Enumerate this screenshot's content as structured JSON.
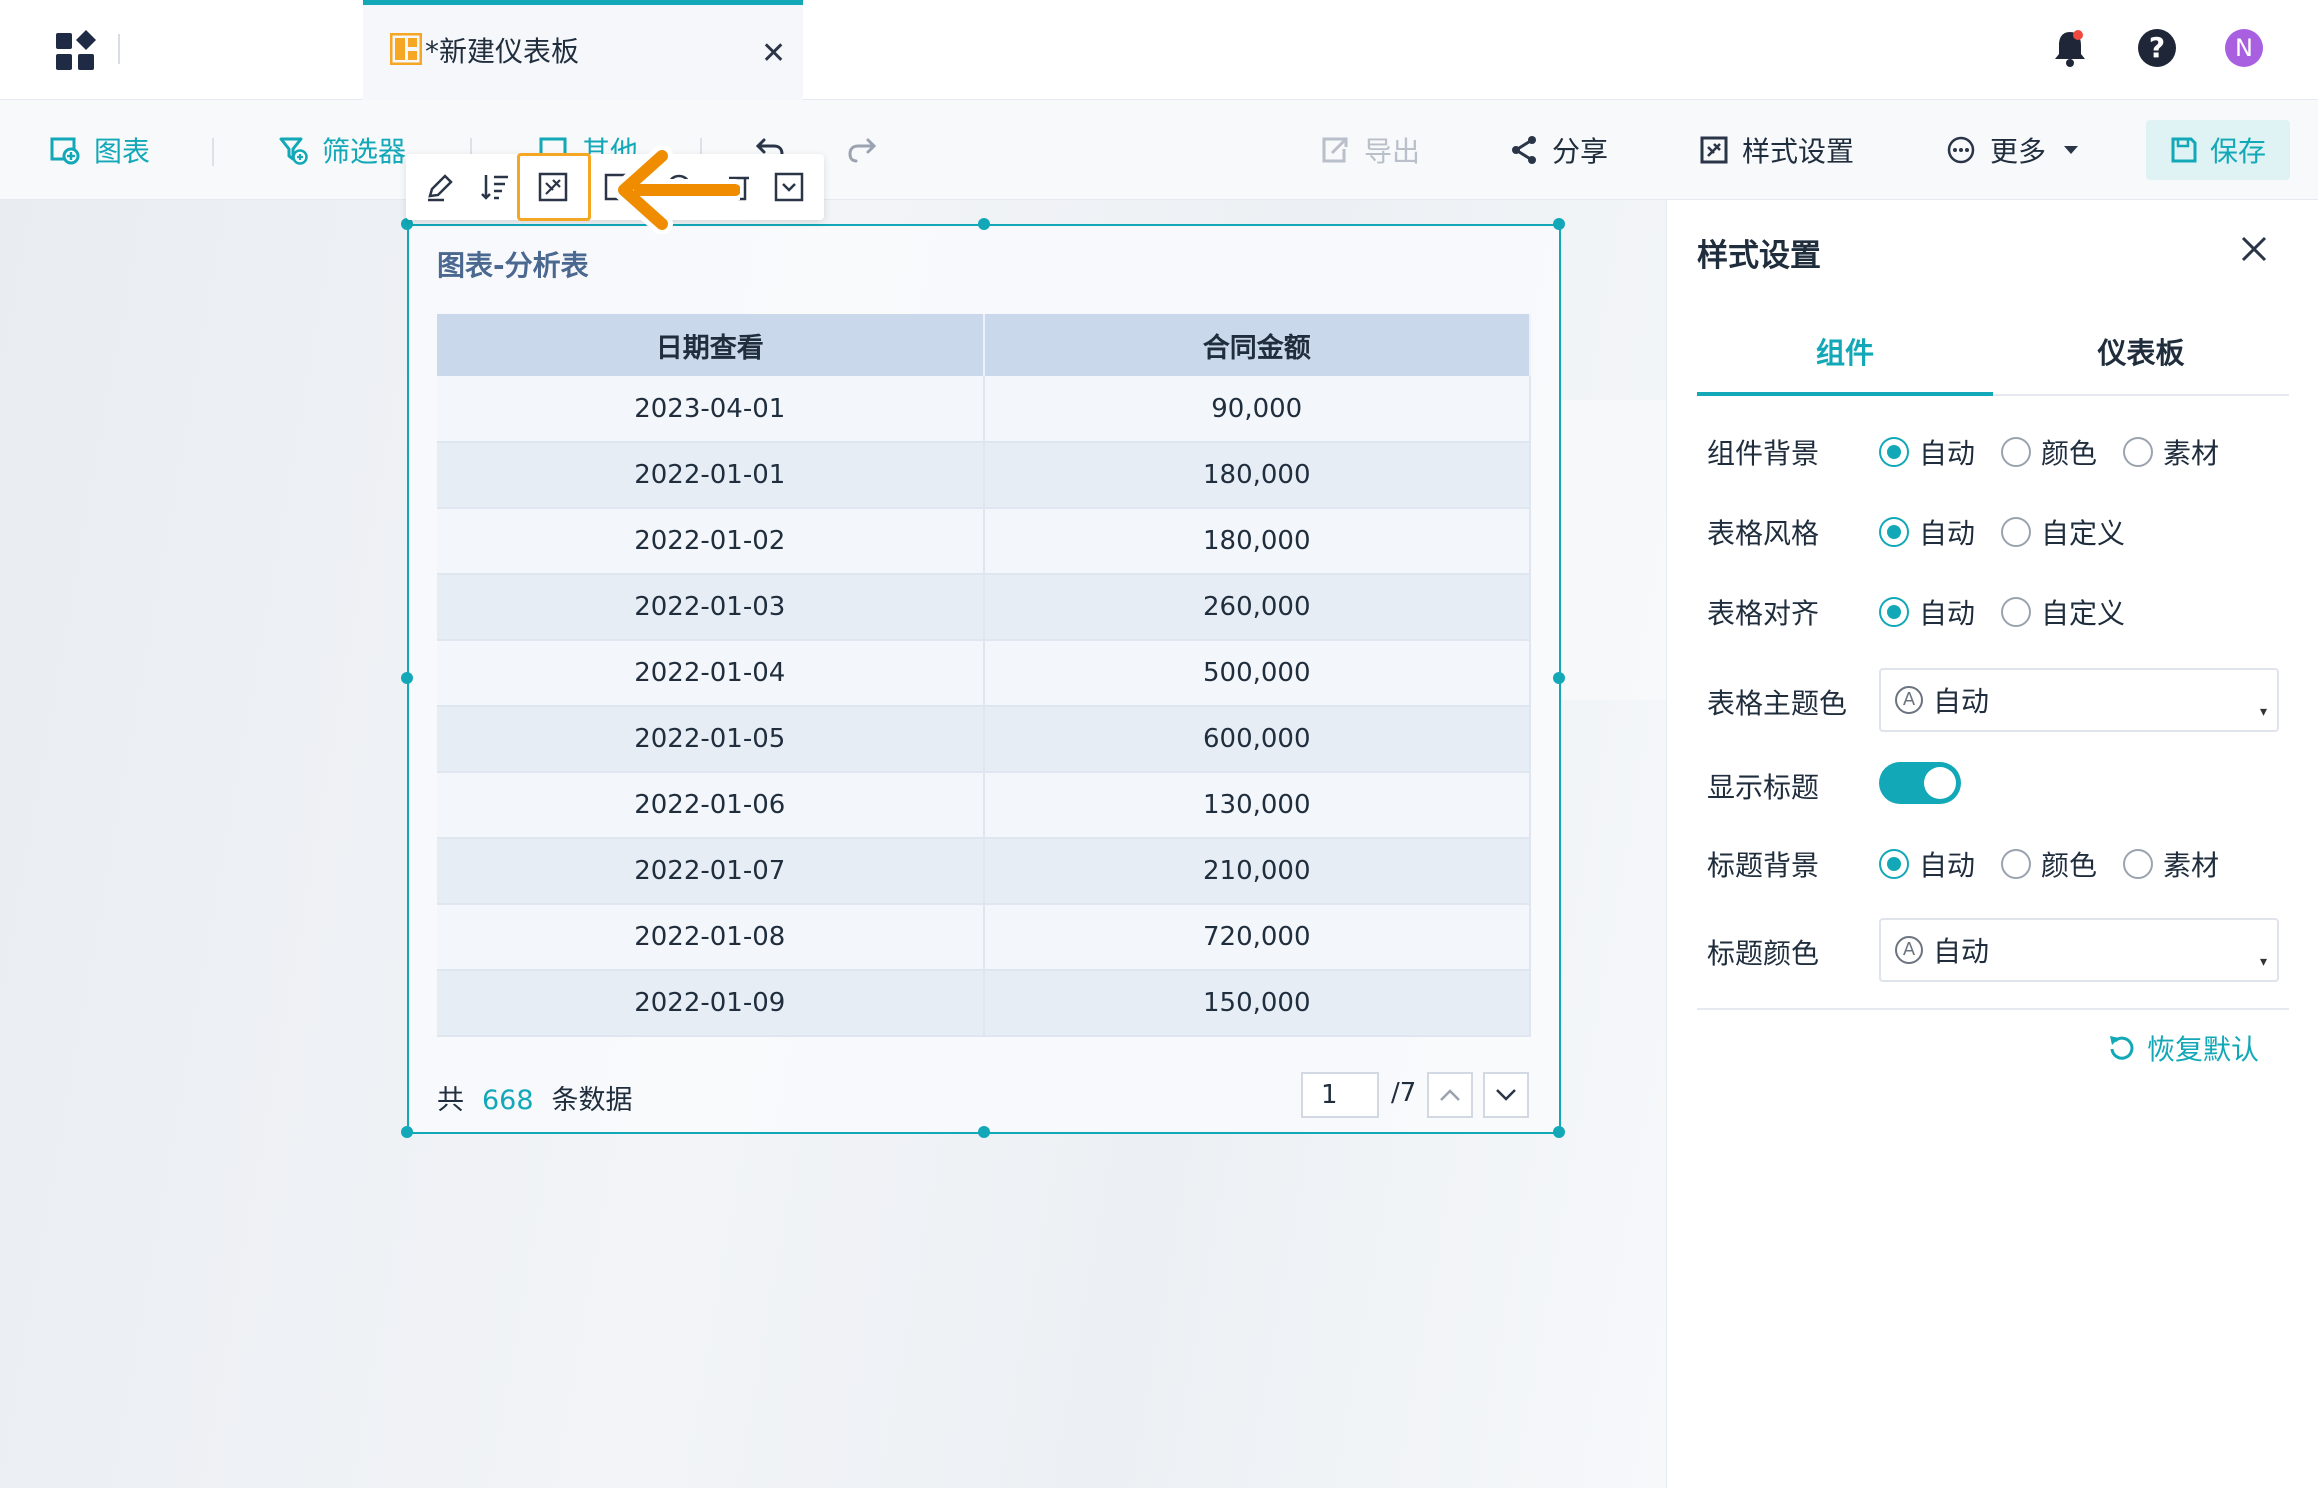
{
  "tabs": {
    "active_title": "*新建仪表板"
  },
  "header": {
    "avatar_letter": "N",
    "help_glyph": "?"
  },
  "toolbar": {
    "chart_label": "图表",
    "filter_label": "筛选器",
    "other_label": "其他",
    "export_label": "导出",
    "share_label": "分享",
    "style_label": "样式设置",
    "more_label": "更多",
    "save_label": "保存"
  },
  "widget": {
    "title": "图表-分析表",
    "columns": [
      "日期查看",
      "合同金额"
    ],
    "rows": [
      [
        "2023-04-01",
        "90,000"
      ],
      [
        "2022-01-01",
        "180,000"
      ],
      [
        "2022-01-02",
        "180,000"
      ],
      [
        "2022-01-03",
        "260,000"
      ],
      [
        "2022-01-04",
        "500,000"
      ],
      [
        "2022-01-05",
        "600,000"
      ],
      [
        "2022-01-06",
        "130,000"
      ],
      [
        "2022-01-07",
        "210,000"
      ],
      [
        "2022-01-08",
        "720,000"
      ],
      [
        "2022-01-09",
        "150,000"
      ]
    ],
    "footer": {
      "prefix": "共",
      "count": "668",
      "suffix": "条数据",
      "page": "1",
      "total_pages": "/7"
    }
  },
  "panel": {
    "title": "样式设置",
    "tabs": [
      "组件",
      "仪表板"
    ],
    "rows": {
      "component_bg": {
        "label": "组件背景",
        "options": [
          "自动",
          "颜色",
          "素材"
        ],
        "selected": 0
      },
      "table_style": {
        "label": "表格风格",
        "options": [
          "自动",
          "自定义"
        ],
        "selected": 0
      },
      "table_align": {
        "label": "表格对齐",
        "options": [
          "自动",
          "自定义"
        ],
        "selected": 0
      },
      "theme_color": {
        "label": "表格主题色",
        "value": "自动",
        "icon_letter": "A"
      },
      "show_title": {
        "label": "显示标题",
        "enabled": true
      },
      "title_bg": {
        "label": "标题背景",
        "options": [
          "自动",
          "颜色",
          "素材"
        ],
        "selected": 0
      },
      "title_color": {
        "label": "标题颜色",
        "value": "自动",
        "icon_letter": "A"
      }
    },
    "restore_label": "恢复默认"
  },
  "colors": {
    "accent": "#12a8b7",
    "highlight": "#f5a623",
    "header_bg": "#c9d8ea"
  }
}
